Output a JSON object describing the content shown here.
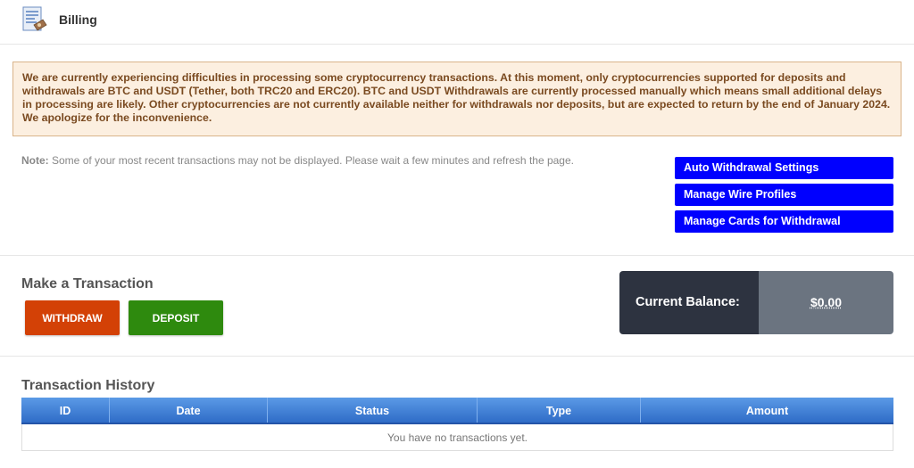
{
  "header": {
    "title": "Billing",
    "icon": "billing-document-icon"
  },
  "notice": {
    "text": "We are currently experiencing difficulties in processing some cryptocurrency transactions. At this moment, only cryptocurrencies supported for deposits and withdrawals are BTC and USDT (Tether, both TRC20 and ERC20). BTC and USDT Withdrawals are currently processed manually which means small additional delays in processing are likely. Other cryptocurrencies are not currently available neither for withdrawals nor deposits, but are expected to return by the end of January 2024. We apologize for the inconvenience."
  },
  "note": {
    "label": "Note:",
    "text": " Some of your most recent transactions may not be displayed. Please wait a few minutes and refresh the page."
  },
  "side_buttons": {
    "auto_withdrawal": "Auto Withdrawal Settings",
    "wire_profiles": "Manage Wire Profiles",
    "cards": "Manage Cards for Withdrawal"
  },
  "transaction": {
    "title": "Make a Transaction",
    "withdraw": "WITHDRAW",
    "deposit": "DEPOSIT"
  },
  "balance": {
    "label": "Current Balance:",
    "value": "$0.00"
  },
  "history": {
    "title": "Transaction History",
    "columns": [
      "ID",
      "Date",
      "Status",
      "Type",
      "Amount"
    ],
    "empty": "You have no transactions yet."
  },
  "colors": {
    "side_button": "#0000ff",
    "withdraw": "#d34106",
    "deposit": "#2e8a0e",
    "balance_label_bg": "#2d3340",
    "balance_value_bg": "#6b7480",
    "notice_bg": "#fcefe0"
  }
}
